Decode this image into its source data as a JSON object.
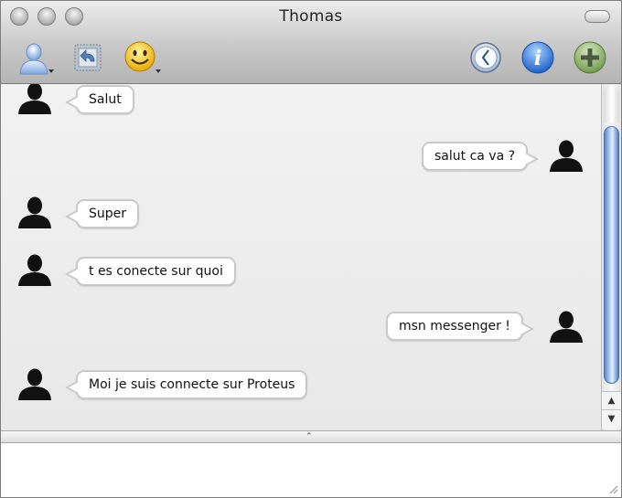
{
  "window": {
    "title": "Thomas"
  },
  "toolbar": {
    "buttons": [
      {
        "name": "buddy-button",
        "icon": "person-icon"
      },
      {
        "name": "history-button",
        "icon": "back-arrow-icon"
      },
      {
        "name": "smiley-button",
        "icon": "smiley-icon"
      },
      {
        "name": "clock-button",
        "icon": "clock-icon"
      },
      {
        "name": "info-button",
        "icon": "info-icon"
      },
      {
        "name": "add-button",
        "icon": "plus-icon"
      }
    ]
  },
  "messages": [
    {
      "side": "left",
      "text": "Salut"
    },
    {
      "side": "right",
      "text": "salut ca va ?"
    },
    {
      "side": "left",
      "text": "Super"
    },
    {
      "side": "left",
      "text": "t es conecte sur quoi"
    },
    {
      "side": "right",
      "text": "msn messenger !"
    },
    {
      "side": "left",
      "text": "Moi je suis connecte sur Proteus"
    }
  ],
  "input": {
    "value": ""
  },
  "colors": {
    "accent": "#5f86c7",
    "bubble_border": "#c9c9c9"
  }
}
